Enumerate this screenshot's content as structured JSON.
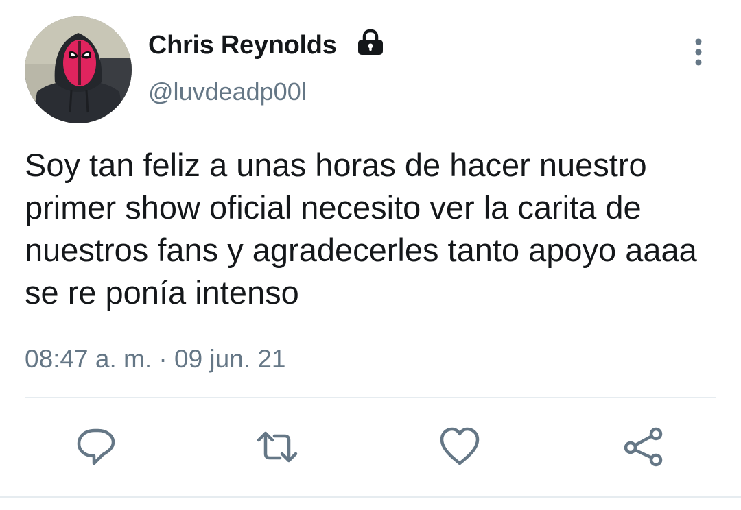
{
  "author": {
    "display_name": "Chris Reynolds",
    "handle": "@luvdeadp00l",
    "protected_icon": "lock-icon",
    "avatar": "avatar-masked-person"
  },
  "tweet": {
    "text": "Soy tan feliz a unas horas de hacer nuestro primer show oficial necesito ver la carita de nuestros fans y agradecerles tanto apoyo aaaa se re ponía intenso",
    "timestamp": "08:47 a. m. · 09 jun. 21"
  },
  "menu_icon": "more-vertical-icon",
  "actions": [
    {
      "name": "reply",
      "icon": "reply-icon"
    },
    {
      "name": "retweet",
      "icon": "retweet-icon"
    },
    {
      "name": "like",
      "icon": "heart-icon"
    },
    {
      "name": "share",
      "icon": "share-icon"
    }
  ],
  "colors": {
    "text": "#14171a",
    "secondary": "#657786",
    "icon": "#657786",
    "divider": "#e6ecf0"
  }
}
